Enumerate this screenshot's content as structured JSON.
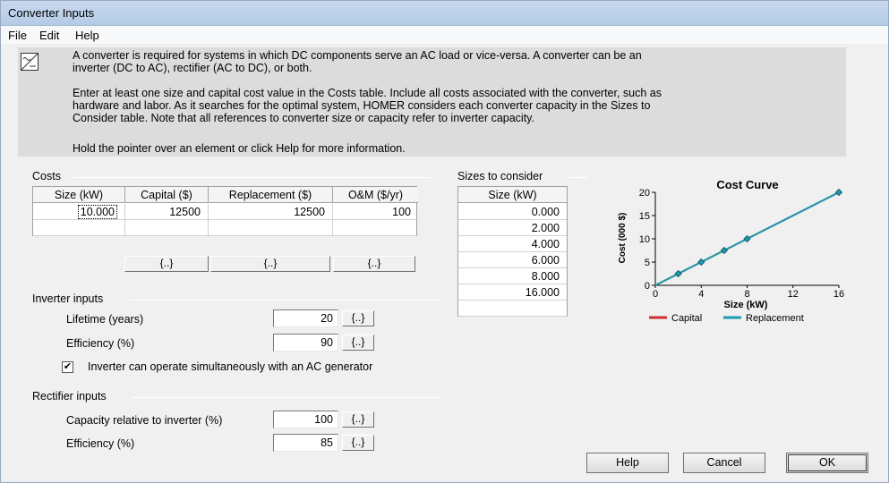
{
  "window": {
    "title": "Converter Inputs"
  },
  "menu": [
    "File",
    "Edit",
    "Help"
  ],
  "info": {
    "p1": [
      "A converter is required for systems in which DC components serve an AC load or vice-versa. A converter can be an",
      "inverter (DC to AC), rectifier (AC to DC), or both."
    ],
    "p2": [
      "Enter at least one size and capital cost value in the Costs table. Include all costs associated with the converter, such as",
      "hardware and labor. As it searches for the optimal system, HOMER considers each converter capacity in the Sizes to",
      "Consider table. Note that all references to converter size or capacity refer to inverter capacity."
    ],
    "p3": "Hold the pointer over an element or click Help for more information."
  },
  "costs": {
    "label": "Costs",
    "headers": [
      "Size (kW)",
      "Capital ($)",
      "Replacement ($)",
      "O&M ($/yr)"
    ],
    "rows": [
      [
        "10.000",
        "12500",
        "12500",
        "100"
      ]
    ],
    "dot_buttons": [
      "{..}",
      "{..}",
      "{..}"
    ]
  },
  "sizes": {
    "label": "Sizes to consider",
    "header": "Size (kW)",
    "values": [
      "0.000",
      "2.000",
      "4.000",
      "6.000",
      "8.000",
      "16.000"
    ]
  },
  "inverter": {
    "label": "Inverter inputs",
    "lifetime_label": "Lifetime (years)",
    "lifetime": "20",
    "efficiency_label": "Efficiency (%)",
    "efficiency": "90",
    "checkbox_label": "Inverter can operate simultaneously with an AC generator",
    "checkbox_mark": "✔",
    "dot": "{..}"
  },
  "rectifier": {
    "label": "Rectifier inputs",
    "capacity_label": "Capacity relative to inverter (%)",
    "capacity": "100",
    "efficiency_label": "Efficiency (%)",
    "efficiency": "85",
    "dot": "{..}"
  },
  "chart_data": {
    "type": "line",
    "title": "Cost Curve",
    "xlabel": "Size (kW)",
    "ylabel": "Cost (000 $)",
    "xlim": [
      0,
      16
    ],
    "ylim": [
      0,
      20
    ],
    "xticks": [
      "0",
      "4",
      "8",
      "12",
      "16"
    ],
    "yticks": [
      "0",
      "5",
      "10",
      "15",
      "20"
    ],
    "x": [
      0,
      2,
      4,
      6,
      8,
      16
    ],
    "series": [
      {
        "name": "Capital",
        "color": "#d03030",
        "values": [
          0,
          2.5,
          5,
          7.5,
          10,
          20
        ]
      },
      {
        "name": "Replacement",
        "color": "#1a9bb0",
        "values": [
          0,
          2.5,
          5,
          7.5,
          10,
          20
        ]
      }
    ],
    "legend_position": "bottom"
  },
  "buttons": {
    "help": "Help",
    "cancel": "Cancel",
    "ok": "OK"
  }
}
